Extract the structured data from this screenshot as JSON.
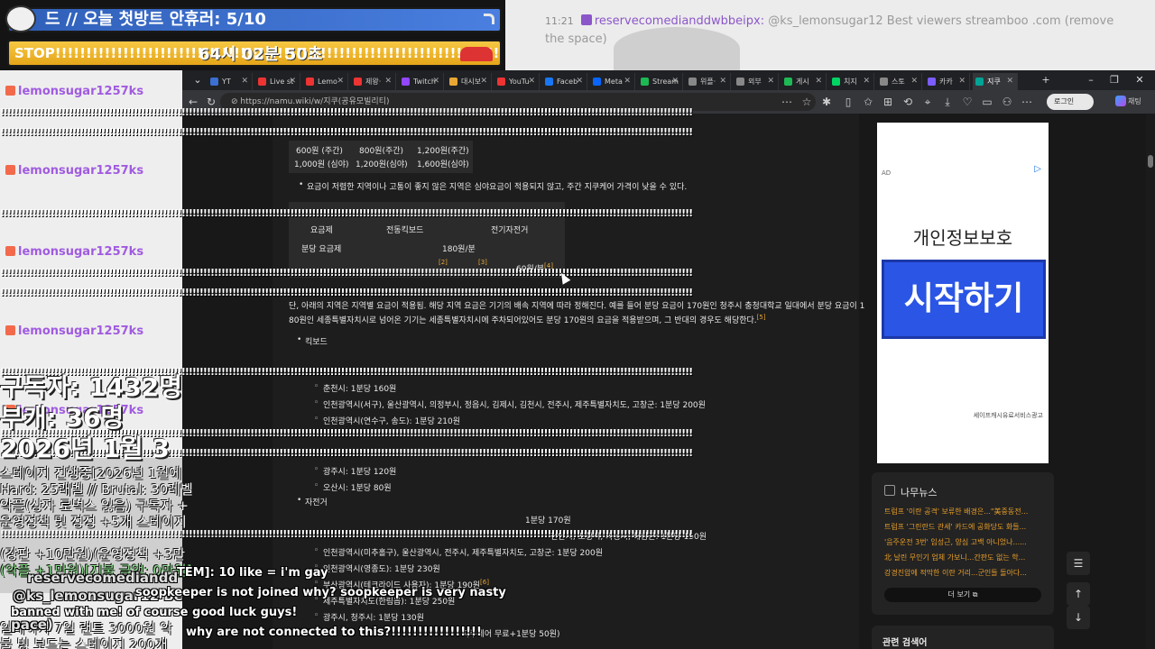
{
  "stream": {
    "goal_label": "드 // 오늘 첫방트 안휴러: 5/10",
    "stop_label": "STOP!!!!!!!!!!!!!!!!!!!!!!!!!!!!!!!!!!!!!!!!!!!!!!!!!!!!!!!!!!!!!!!!!!!!!!!!",
    "timer": "64시 02분 50초",
    "top_chat": {
      "time": "11:21",
      "user": "reservecomedianddwbbeipx:",
      "message": "@ks_lemonsugar12 Best viewers streamboo .com (remove the space)"
    },
    "chat_user": "lemonsugar1257ks",
    "stats": {
      "subscribers": "구독자: 1432명",
      "members": "부캐: 36명",
      "date": "2026년 1월 3",
      "line1": "스테이지 진행중[2026년 1월에",
      "line2": "Hard: 25래벨 // Brutal: 30레벨",
      "line3": "악플(상자 로벅스 잃음) 구독자 +",
      "line4": "운영정책 및 정정 +5개 스테이지",
      "line5": "(강판 +10만원)(운영정책 +3만",
      "line6": "(악플 +1만원)[지불 금액: 0만원]",
      "line7": "일페이지 7일 랜트 3000원 악",
      "line8": "불 빙 보드는 스테이지 200개"
    }
  },
  "browser": {
    "tabs": [
      {
        "label": "YT",
        "color": "#3b6fd1"
      },
      {
        "label": "Live st",
        "color": "#e33"
      },
      {
        "label": "Lemo",
        "color": "#e33"
      },
      {
        "label": "제왕·",
        "color": "#e33"
      },
      {
        "label": "Twitch",
        "color": "#9146ff"
      },
      {
        "label": "대시보",
        "color": "#e8a735"
      },
      {
        "label": "YouTu",
        "color": "#e33"
      },
      {
        "label": "Faceb",
        "color": "#1877f2"
      },
      {
        "label": "Meta",
        "color": "#0866ff"
      },
      {
        "label": "Stream",
        "color": "#1db954"
      },
      {
        "label": "위플·",
        "color": "#888"
      },
      {
        "label": "외부",
        "color": "#888"
      },
      {
        "label": "게시",
        "color": "#1db954"
      },
      {
        "label": "치지",
        "color": "#00d564"
      },
      {
        "label": "스토",
        "color": "#888"
      },
      {
        "label": "카카",
        "color": "#7b5cff"
      },
      {
        "label": "지쿠",
        "color": "#00a495"
      }
    ],
    "url": "https://namu.wiki/w/지쿠(공유모빌리티)",
    "login": "로그인",
    "ai_label": "채팅"
  },
  "doc": {
    "prices_row1": [
      "600원 (주간)",
      "800원(주간)",
      "1,200원(주간)"
    ],
    "prices_row2": [
      "1,000원 (심야)",
      "1,200원(심야)",
      "1,600원(심야)"
    ],
    "note1": "요금이 저렴한 지역이나 고통이 좋지 않은 지역은 심야요금이 적용되지 않고, 주간 지쿠케어 가격이 낮을 수 있다.",
    "table_head": [
      "요금제",
      "전동킥보드",
      "전기자전거"
    ],
    "table_row": [
      "분당 요금제",
      "180원/분"
    ],
    "table_row2": "60원/분",
    "para": "단, 아래의 지역은 지역별 요금이 적용됨. 해당 지역 요금은 기기의 배속 지역에 따라 정해진다. 예를 들어 분당 요금이 170원인 청주시 충청대학교 일대에서 분당 요금이 1",
    "para2": "80원인 세종특별자치시로 넘어온 기기는 세종특별자치시에 주차되어있어도 분당 170원의 요금을 적용받으며, 그 반대의 경우도 해당한다.",
    "para_ref": "[5]",
    "kick_heading": "킥보드",
    "kick": [
      "춘천시: 1분당 160원",
      "인천광역시(서구), 울산광역시, 의정부시, 정읍시, 김제시, 김천시, 전주시, 제주특별자치도, 고창군: 1분당 200원",
      "인천광역시(연수구, 송도): 1분당 210원",
      "광주시: 1분당 120원",
      "오산시: 1분당 80원"
    ],
    "bike_heading": "자전거",
    "bike": [
      "1분당 170원",
      "천안시, 포항시, 화성시, 해남군: 1분당 150원",
      "인천광역시(미추홀구), 울산광역시, 전주시, 제주특별자치도, 고창군: 1분당 200원",
      "인천광역시(영종도): 1분당 230원",
      "부산광역시(테크라이드 사용자): 1분당 190원",
      "제주특별자치도(한림읍): 1분당 250원",
      "광주시, 청주시: 1분당 130원",
      "지쿠케어 무료+1분당 50원)"
    ],
    "refs": {
      "r2": "[2]",
      "r3": "[3]",
      "r4": "[4]",
      "r6": "[6]"
    }
  },
  "ad": {
    "tag": "AD",
    "headline": "개인정보보호",
    "cta": "시작하기",
    "sponsor": "세이프캐시유료서비스광고"
  },
  "news": {
    "title": "나무뉴스",
    "items": [
      "트럼프 '이란 공격' 보류한 배경은...\"美중동전...",
      "트럼프 '그린란드 관세' 카드에 공화당도 화들...",
      "'음주운전 3번' 임성근, 양심 고백 아니었나......",
      "北 날린 무인기 업체 가보니...간판도 없는 학...",
      "강경진압에 적막한 이란 거리...군인들 돌아다..."
    ],
    "more": "더 보기",
    "related": "관련 검색어"
  },
  "overlay": {
    "spam": "!!!!!!!!!!!!!!!!!!!!!!!!!!!!!!!!!!!!!!!!!!!!!!!!!!!!!!!!!!!!!!!!!!!!!!!!!!!!!!!!!!!!!!!!!!!!!!!!!!!!!!!!!!!!!!!!!!!!!!!!!!!!!!!!!!!!!!!!!!!!!!!!!!!!!!!!!!!!!!!!!!!!!!!!!!!!!!!!!!!!!!!!!!!!!!!",
    "m1": "TEM]: 10 like = i'm gay",
    "m2": "reservecomediandd",
    "m3": "@ks_lemonsugar12 Be",
    "m4": "soopkeeper is not joined why? soopkeeper is very nasty",
    "m5": "banned with me! of course good luck guys!",
    "m6": "pace)",
    "m7": "why are not connected to this?!!!!!!!!!!!!!!!!!"
  }
}
